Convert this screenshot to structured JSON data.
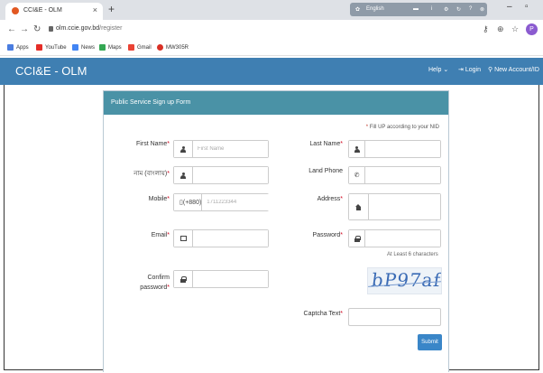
{
  "browser": {
    "tab_title": "CCI&E - OLM",
    "tab_close": "×",
    "new_tab": "+",
    "ext_label": "English",
    "url_host": "olm.ccie.gov.bd",
    "url_path": "/register",
    "profile_initial": "P",
    "bookmarks": [
      {
        "label": "Apps",
        "color": "#4a7de0"
      },
      {
        "label": "YouTube",
        "color": "#e52d27"
      },
      {
        "label": "News",
        "color": "#4285f4"
      },
      {
        "label": "Maps",
        "color": "#34a853"
      },
      {
        "label": "Gmail",
        "color": "#ea4335"
      },
      {
        "label": "MW305R",
        "color": "#d93025"
      }
    ]
  },
  "navbar": {
    "brand": "CCI&E - OLM",
    "help": "Help",
    "login": "Login",
    "new_account": "New Account/ID",
    "bg_color": "#3f7fb2"
  },
  "form": {
    "heading": "Public Service Sign up Form",
    "nid_note_star": "*",
    "nid_note": "Fill UP according to your NID",
    "first_name_label": "First Name",
    "first_name_placeholder": "First Name",
    "last_name_label": "Last Name",
    "bangla_name_label": "নাম (বাংলায়)",
    "land_phone_label": "Land Phone",
    "mobile_label": "Mobile",
    "mobile_prefix": "(+880)",
    "mobile_placeholder": "1711223344",
    "address_label": "Address",
    "email_label": "Email",
    "password_label": "Password",
    "password_hint": "At Least 6 characters",
    "confirm_label_1": "Confirm",
    "confirm_label_2": "password",
    "captcha_image_text": "bP97af",
    "captcha_label": "Captcha Text",
    "submit": "Submit",
    "required_mark": "*"
  }
}
